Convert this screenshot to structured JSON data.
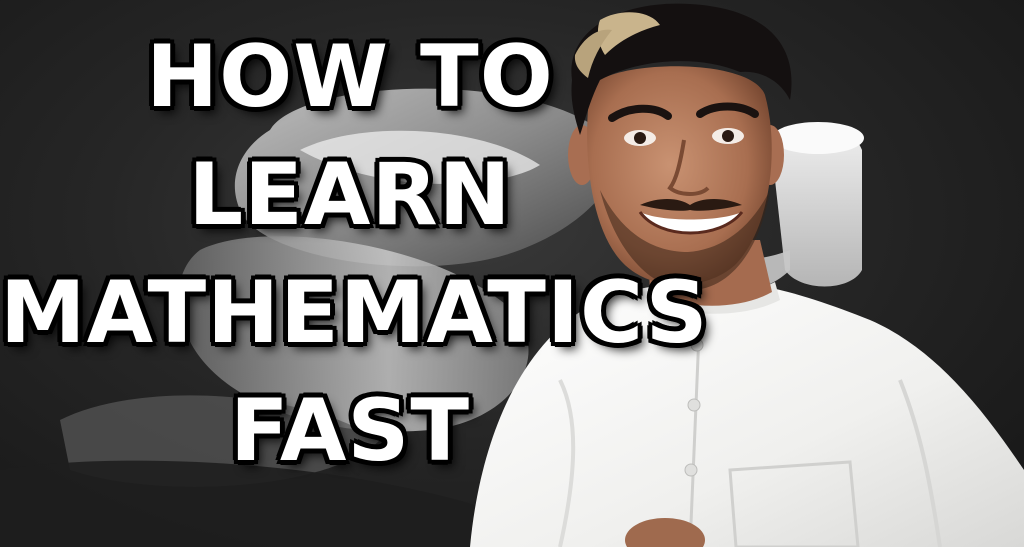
{
  "thumbnail": {
    "headline_lines": [
      "HOW TO",
      "LEARN",
      "MATHEMATICS",
      "FAST"
    ]
  },
  "colors": {
    "background": "#262626",
    "headline_fill": "#ffffff",
    "headline_outline": "#000000",
    "shirt": "#f2f2f0"
  }
}
